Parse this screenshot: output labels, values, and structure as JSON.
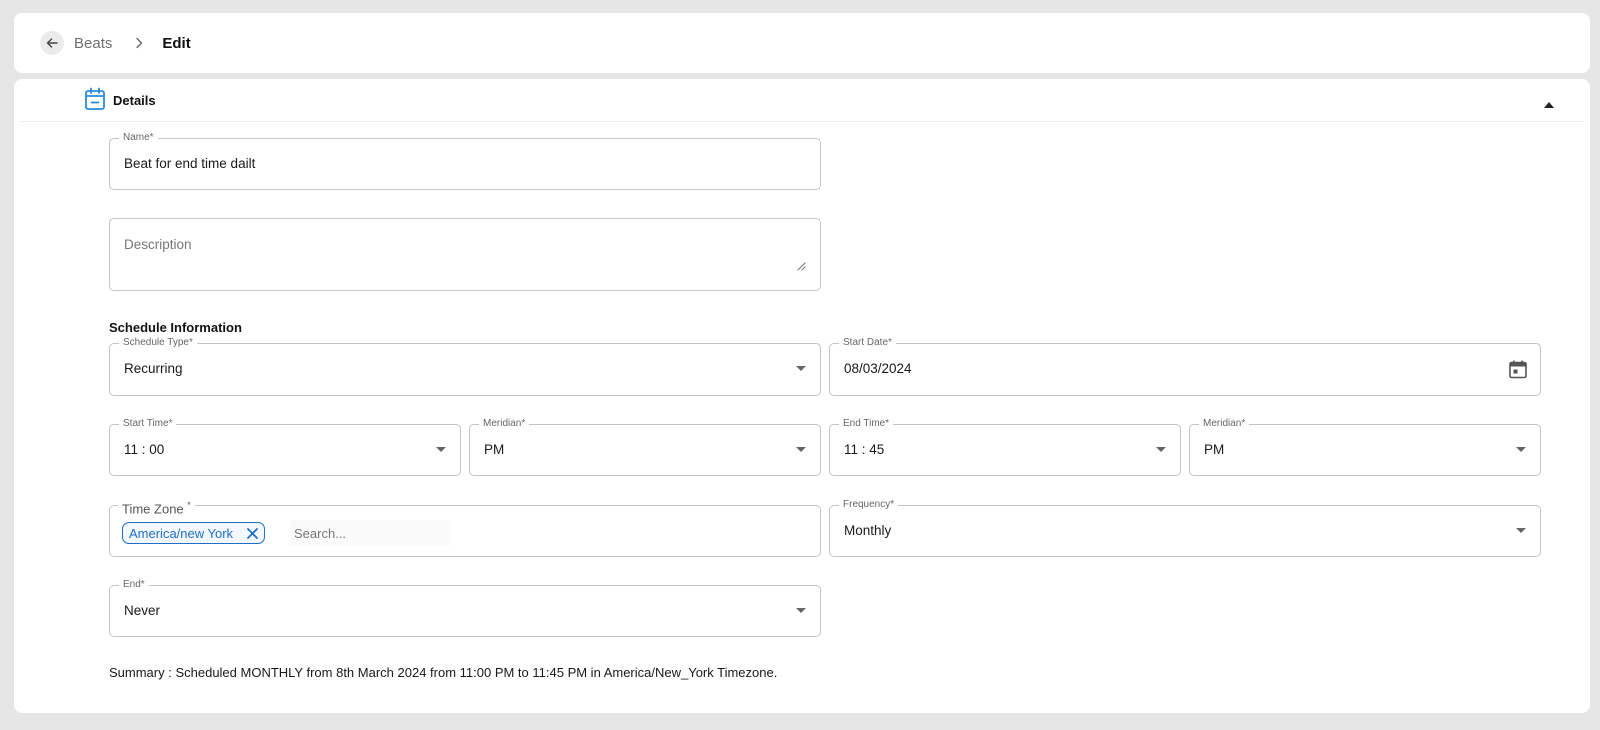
{
  "breadcrumb": {
    "parent": "Beats",
    "current": "Edit"
  },
  "section": {
    "title": "Details"
  },
  "form": {
    "name": {
      "label": "Name*",
      "value": "Beat for end time dailt"
    },
    "description": {
      "placeholder": "Description",
      "value": ""
    },
    "schedule_heading": "Schedule Information",
    "schedule_type": {
      "label": "Schedule Type*",
      "value": "Recurring"
    },
    "start_date": {
      "label": "Start Date*",
      "value": "08/03/2024"
    },
    "start_time": {
      "label": "Start Time*",
      "value": "11 : 00"
    },
    "start_meridian": {
      "label": "Meridian*",
      "value": "PM"
    },
    "end_time": {
      "label": "End Time*",
      "value": "11 : 45"
    },
    "end_meridian": {
      "label": "Meridian*",
      "value": "PM"
    },
    "time_zone": {
      "label": "Time Zone",
      "required_mark": "*",
      "chip": "America/new York",
      "search_placeholder": "Search..."
    },
    "frequency": {
      "label": "Frequency*",
      "value": "Monthly"
    },
    "end": {
      "label": "End*",
      "value": "Never"
    }
  },
  "summary": "Summary : Scheduled MONTHLY from 8th March 2024 from 11:00 PM to 11:45 PM in America/New_York Timezone.",
  "colors": {
    "accent": "#1f6fc5",
    "section_icon": "#2a8ad8",
    "page_bg": "#e6e6e6"
  },
  "icons": {
    "back": "arrow-left-icon",
    "separator": "chevron-right-icon",
    "section": "calendar-minus-icon",
    "collapse": "caret-up-icon",
    "date_picker": "calendar-icon",
    "chip_remove": "close-icon",
    "dropdown": "caret-down-icon"
  }
}
